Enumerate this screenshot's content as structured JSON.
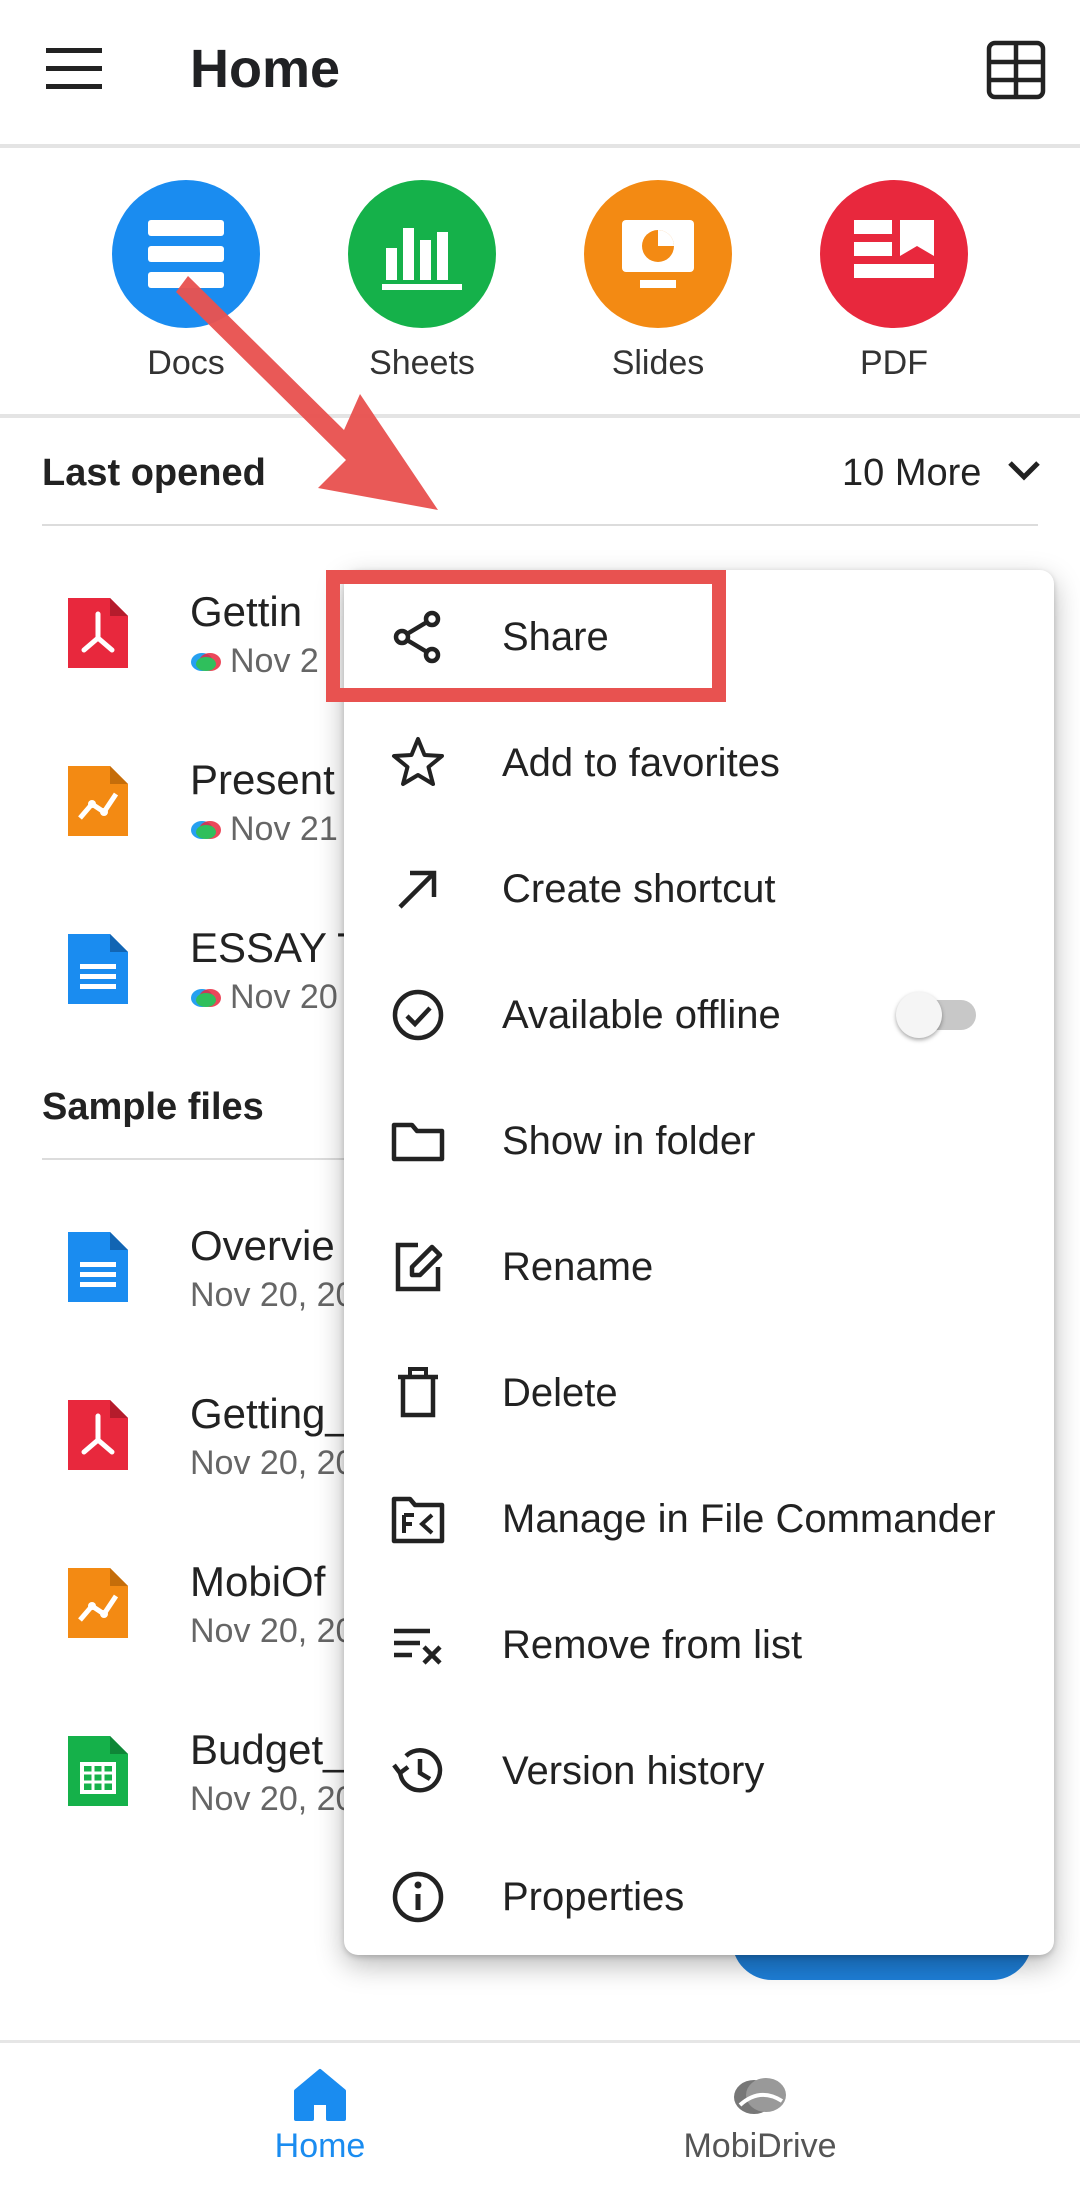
{
  "header": {
    "title": "Home"
  },
  "apps": [
    {
      "label": "Docs",
      "color": "#1a8cf0"
    },
    {
      "label": "Sheets",
      "color": "#15b14a"
    },
    {
      "label": "Slides",
      "color": "#f38a13"
    },
    {
      "label": "PDF",
      "color": "#e8283d"
    }
  ],
  "last_opened": {
    "title": "Last opened",
    "more_label": "10 More",
    "files": [
      {
        "name": "Gettin",
        "meta": "Nov 2",
        "type": "pdf"
      },
      {
        "name": "Present",
        "meta": "Nov 21",
        "type": "slides"
      },
      {
        "name": "ESSAY T",
        "meta": "Nov 20",
        "type": "docs"
      }
    ]
  },
  "sample_files": {
    "title": "Sample files",
    "files": [
      {
        "name": "Overvie",
        "meta": "Nov 20, 20",
        "type": "docs"
      },
      {
        "name": "Getting_",
        "meta": "Nov 20, 20",
        "type": "pdf"
      },
      {
        "name": "MobiOf",
        "meta": "Nov 20, 20",
        "type": "slides"
      },
      {
        "name": "Budget_",
        "meta": "Nov 20, 20",
        "type": "sheets"
      }
    ]
  },
  "context_menu": {
    "items": [
      {
        "label": "Share",
        "icon": "share-icon"
      },
      {
        "label": "Add to favorites",
        "icon": "star-icon"
      },
      {
        "label": "Create shortcut",
        "icon": "arrow-up-right-icon"
      },
      {
        "label": "Available offline",
        "icon": "check-circle-icon",
        "toggle": false
      },
      {
        "label": "Show in folder",
        "icon": "folder-icon"
      },
      {
        "label": "Rename",
        "icon": "edit-icon"
      },
      {
        "label": "Delete",
        "icon": "trash-icon"
      },
      {
        "label": "Manage in File Commander",
        "icon": "file-commander-icon"
      },
      {
        "label": "Remove from list",
        "icon": "remove-list-icon"
      },
      {
        "label": "Version history",
        "icon": "history-icon"
      },
      {
        "label": "Properties",
        "icon": "info-icon"
      }
    ]
  },
  "bottom_nav": {
    "home_label": "Home",
    "drive_label": "MobiDrive",
    "active_color": "#1a8cf0",
    "inactive_color": "#555555"
  },
  "colors": {
    "annotation_red": "#e85250"
  }
}
